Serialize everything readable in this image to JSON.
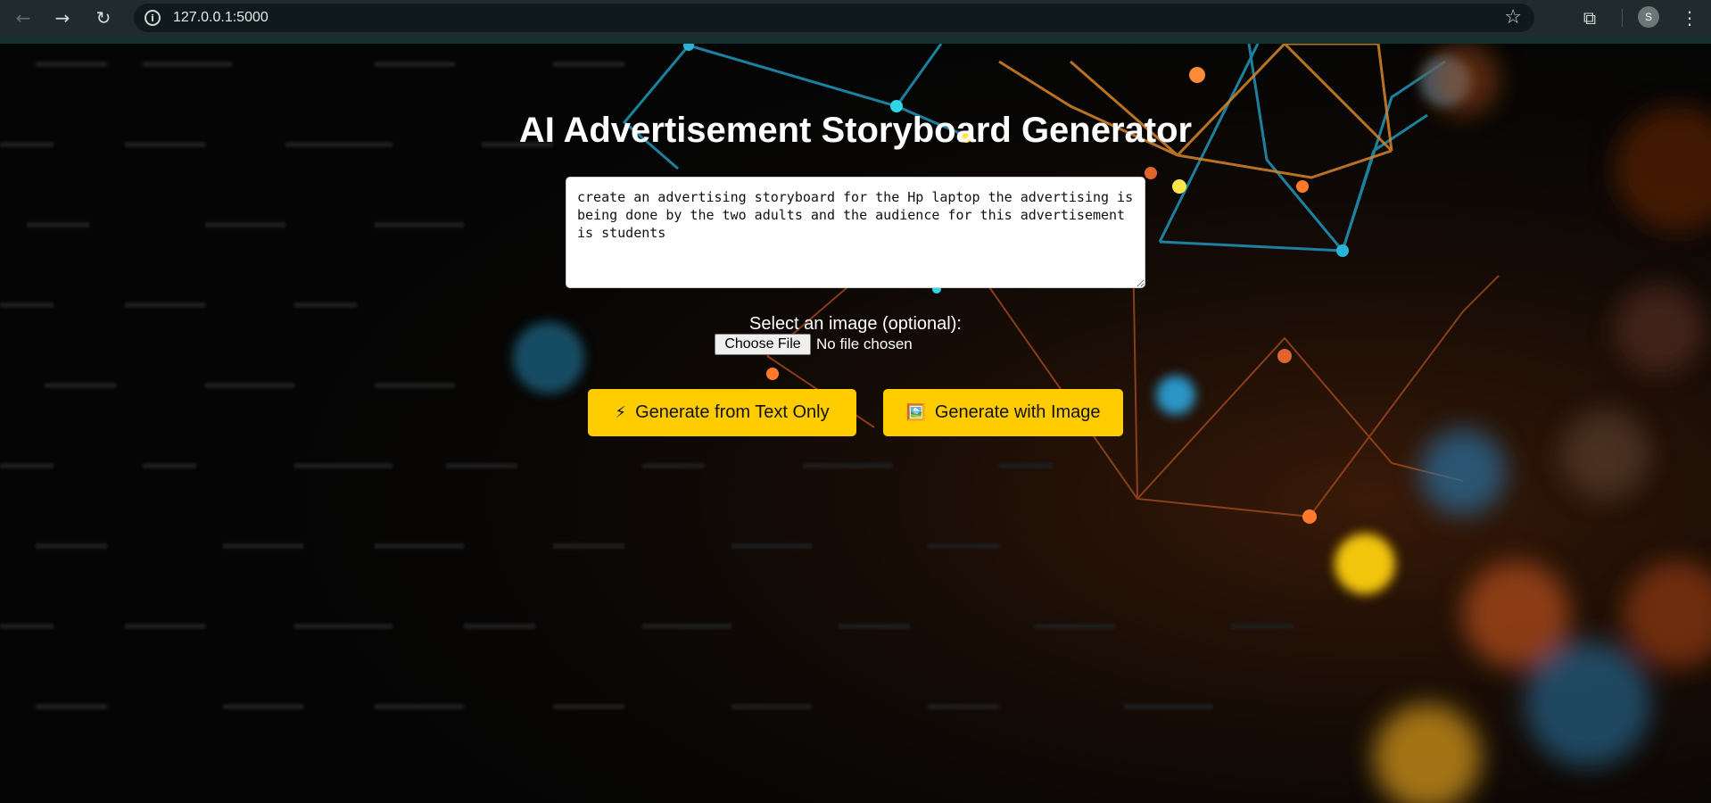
{
  "browser": {
    "url": "127.0.0.1:5000",
    "profile_initial": "S",
    "icons": {
      "back": "back-arrow-icon",
      "forward": "forward-arrow-icon",
      "reload": "reload-icon",
      "info": "site-info-icon",
      "bookmark": "star-icon",
      "extensions": "extensions-icon",
      "menu": "kebab-menu-icon"
    }
  },
  "page": {
    "title": "AI Advertisement Storyboard Generator",
    "prompt_value": "create an advertising storyboard for the Hp laptop the advertising is being done by the two adults and the audience for this advertisement is students",
    "file_label": "Select an image (optional):",
    "choose_file_label": "Choose File",
    "no_file_text": "No file chosen",
    "buttons": {
      "text_only": {
        "icon": "⚡",
        "label": "Generate from Text Only"
      },
      "with_image": {
        "icon": "🖼️",
        "label": "Generate with Image"
      }
    }
  },
  "colors": {
    "accent": "#ffcc00",
    "chrome": "#1f2b2d",
    "background": "#050505"
  }
}
